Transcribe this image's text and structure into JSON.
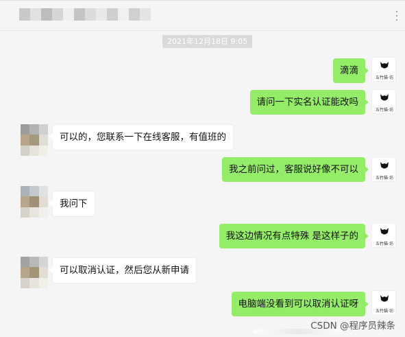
{
  "header": {
    "more_icon": "more-dots-icon"
  },
  "timestamp": "2021年12月18日 9:05",
  "messages": [
    {
      "side": "me",
      "text": "滴滴"
    },
    {
      "side": "me",
      "text": "请问一下实名认证能改吗"
    },
    {
      "side": "them",
      "text": "可以的，您联系一下在线客服，有值班的"
    },
    {
      "side": "me",
      "text": "我之前问过，客服说好像不可以"
    },
    {
      "side": "them",
      "text": "我问下"
    },
    {
      "side": "me",
      "text": "我这边情况有点特殊 是这样子的"
    },
    {
      "side": "them",
      "text": "可以取消认证，然后您从新申请"
    },
    {
      "side": "me",
      "text": "电脑端没看到可以取消认证呀"
    }
  ],
  "my_avatar": {
    "icon": "cat-avatar-icon",
    "caption": "五竹猫·坊"
  },
  "watermark": "CSDN @程序员辣条",
  "colors": {
    "my_bubble": "#95ec69",
    "their_bubble": "#ffffff",
    "background": "#f5f5f5"
  }
}
